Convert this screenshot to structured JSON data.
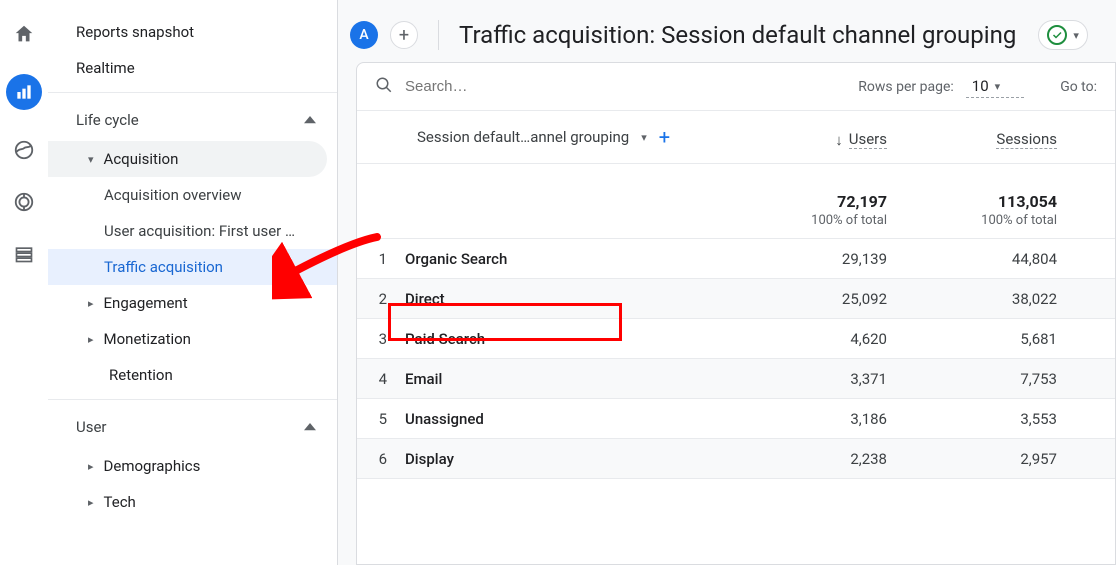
{
  "rail": {
    "home": "home",
    "reports": "reports",
    "explore": "explore",
    "ads": "ads",
    "library": "library"
  },
  "sidebar": {
    "top": [
      {
        "label": "Reports snapshot"
      },
      {
        "label": "Realtime"
      }
    ],
    "lifecycle_label": "Life cycle",
    "acquisition_label": "Acquisition",
    "acquisition_items": [
      "Acquisition overview",
      "User acquisition: First user …",
      "Traffic acquisition"
    ],
    "engagement_label": "Engagement",
    "monetization_label": "Monetization",
    "retention_label": "Retention",
    "user_label": "User",
    "demographics_label": "Demographics",
    "tech_label": "Tech"
  },
  "header": {
    "segment_letter": "A",
    "title": "Traffic acquisition: Session default channel grouping"
  },
  "controls": {
    "search_placeholder": "Search…",
    "rows_label": "Rows per page:",
    "rows_value": "10",
    "goto_label": "Go to:"
  },
  "table": {
    "dimension_label": "Session default…annel grouping",
    "metric1": "Users",
    "metric2": "Sessions",
    "total_users": "72,197",
    "total_users_sub": "100% of total",
    "total_sessions": "113,054",
    "total_sessions_sub": "100% of total",
    "rows": [
      {
        "idx": "1",
        "dim": "Organic Search",
        "users": "29,139",
        "sessions": "44,804"
      },
      {
        "idx": "2",
        "dim": "Direct",
        "users": "25,092",
        "sessions": "38,022"
      },
      {
        "idx": "3",
        "dim": "Paid Search",
        "users": "4,620",
        "sessions": "5,681"
      },
      {
        "idx": "4",
        "dim": "Email",
        "users": "3,371",
        "sessions": "7,753"
      },
      {
        "idx": "5",
        "dim": "Unassigned",
        "users": "3,186",
        "sessions": "3,553"
      },
      {
        "idx": "6",
        "dim": "Display",
        "users": "2,238",
        "sessions": "2,957"
      }
    ]
  }
}
